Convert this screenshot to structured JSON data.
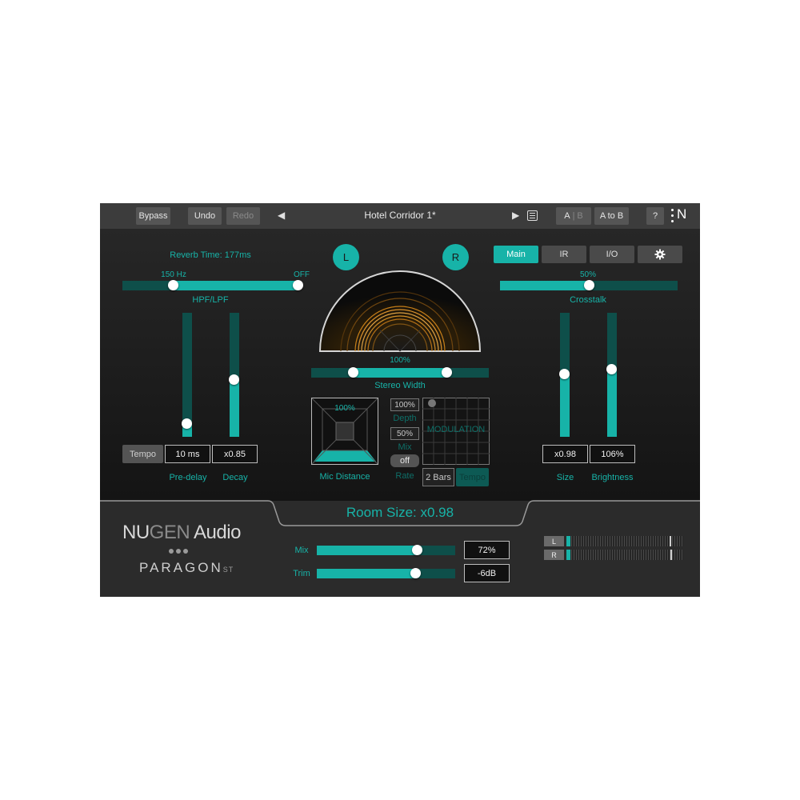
{
  "toolbar": {
    "bypass": "Bypass",
    "undo": "Undo",
    "redo": "Redo",
    "prev_icon": "◀",
    "preset_name": "Hotel Corridor 1*",
    "next_icon": "▶",
    "ab_a": "A",
    "ab_sep": "|",
    "ab_b": "B",
    "a_to_b": "A to B",
    "help": "?",
    "logo": "N"
  },
  "left": {
    "reverb_time": "Reverb Time: 177ms",
    "hpf_value": "150 Hz",
    "lpf_value": "OFF",
    "hpf_lpf_label": "HPF/LPF",
    "tempo_button": "Tempo",
    "predelay_value": "10 ms",
    "decay_value": "x0.85",
    "predelay_label": "Pre-delay",
    "decay_label": "Decay",
    "predelay_level": 0.1,
    "decay_level": 0.46,
    "hpf_position": 0.29,
    "lpf_position": 1.0
  },
  "center": {
    "left_channel": "L",
    "right_channel": "R",
    "stereo_width_value": "100%",
    "stereo_width_label": "Stereo Width",
    "mic_distance_value": "100%",
    "mic_distance_label": "Mic Distance",
    "depth_value": "100%",
    "depth_label": "Depth",
    "mix_value": "50%",
    "mix_label": "Mix",
    "mod_toggle": "off",
    "rate_label": "Rate",
    "rate_value": "2 Bars",
    "rate_tempo": "Tempo",
    "modulation_label": "MODULATION"
  },
  "right": {
    "tabs": [
      "Main",
      "IR",
      "I/O"
    ],
    "settings_icon": "gear-icon",
    "crosstalk_value": "50%",
    "crosstalk_label": "Crosstalk",
    "size_value": "x0.98",
    "brightness_value": "106%",
    "size_label": "Size",
    "brightness_label": "Brightness",
    "size_level": 0.5,
    "brightness_level": 0.54,
    "crosstalk_level": 0.5
  },
  "bottom": {
    "room_size": "Room Size: x0.98",
    "brand_nu": "NU",
    "brand_gen": "GEN",
    "brand_audio": " Audio",
    "product": "PARAGON",
    "product_suffix": "ST",
    "mix_label": "Mix",
    "mix_value": "72%",
    "mix_level": 0.72,
    "trim_label": "Trim",
    "trim_value": "-6dB",
    "trim_level": 0.71,
    "meter_left": "L",
    "meter_right": "R"
  },
  "colors": {
    "accent": "#17b3a8",
    "accent_dark": "#0e4f4a",
    "panel": "#1c1c1c",
    "toolbar": "#3c3c3c"
  }
}
